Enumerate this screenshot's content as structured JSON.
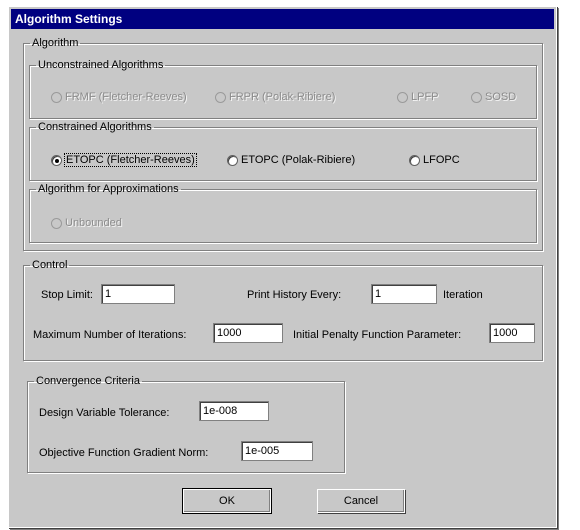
{
  "window": {
    "title": "Algorithm Settings"
  },
  "algorithm": {
    "legend": "Algorithm",
    "unconstrained": {
      "legend": "Unconstrained Algorithms",
      "options": [
        "FRMF (Fletcher-Reeves)",
        "FRPR (Polak-Ribiere)",
        "LPFP",
        "SOSD"
      ]
    },
    "constrained": {
      "legend": "Constrained Algorithms",
      "options": [
        "ETOPC (Fletcher-Reeves)",
        "ETOPC (Polak-Ribiere)",
        "LFOPC"
      ],
      "selected": "ETOPC (Fletcher-Reeves)"
    },
    "approximations": {
      "legend": "Algorithm for Approximations",
      "options": [
        "Unbounded"
      ]
    }
  },
  "control": {
    "legend": "Control",
    "stop_limit_label": "Stop Limit:",
    "stop_limit_value": "1",
    "print_history_label": "Print History Every:",
    "print_history_value": "1",
    "iteration_suffix": "Iteration",
    "max_iterations_label": "Maximum Number of Iterations:",
    "max_iterations_value": "1000",
    "penalty_label": "Initial Penalty Function Parameter:",
    "penalty_value": "1000"
  },
  "convergence": {
    "legend": "Convergence Criteria",
    "design_tol_label": "Design Variable Tolerance:",
    "design_tol_value": "1e-008",
    "grad_norm_label": "Objective Function Gradient Norm:",
    "grad_norm_value": "1e-005"
  },
  "buttons": {
    "ok": "OK",
    "cancel": "Cancel"
  }
}
